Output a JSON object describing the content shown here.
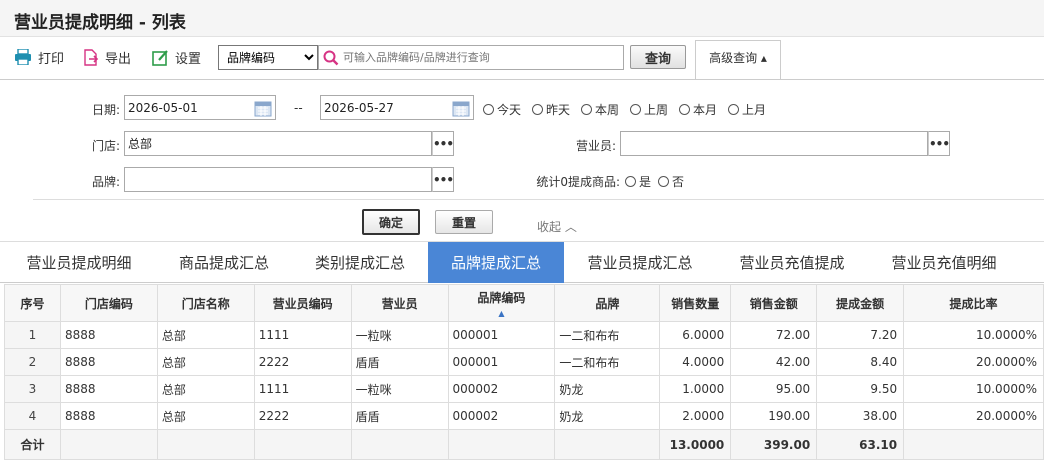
{
  "page_title": "营业员提成明细 - 列表",
  "toolbar": {
    "print_label": "打印",
    "export_label": "导出",
    "settings_label": "设置",
    "field_select_value": "品牌编码",
    "field_options": [
      "品牌编码"
    ],
    "search_placeholder": "可输入品牌编码/品牌进行查询",
    "query_label": "查询",
    "advanced_label": "高级查询 ▴"
  },
  "filters": {
    "date_label": "日期:",
    "date_from": "2026-05-01",
    "date_sep": "--",
    "date_to": "2026-05-27",
    "quick_dates": [
      "今天",
      "昨天",
      "本周",
      "上周",
      "本月",
      "上月"
    ],
    "store_label": "门店:",
    "store_value": "总部",
    "salesperson_label": "营业员:",
    "salesperson_value": "",
    "brand_label": "品牌:",
    "brand_value": "",
    "zero_label": "统计0提成商品:",
    "zero_yes": "是",
    "zero_no": "否",
    "dots": "•••",
    "confirm_label": "确定",
    "reset_label": "重置",
    "collapse_label": "收起 ︿"
  },
  "tabs": [
    "营业员提成明细",
    "商品提成汇总",
    "类别提成汇总",
    "品牌提成汇总",
    "营业员提成汇总",
    "营业员充值提成",
    "营业员充值明细"
  ],
  "active_tab": 3,
  "table": {
    "headers": [
      "序号",
      "门店编码",
      "门店名称",
      "营业员编码",
      "营业员",
      "品牌编码",
      "品牌",
      "销售数量",
      "销售金额",
      "提成金额",
      "提成比率"
    ],
    "sort_indicator": "▲",
    "rows": [
      [
        "1",
        "8888",
        "总部",
        "1111",
        "一粒咪",
        "000001",
        "一二和布布",
        "6.0000",
        "72.00",
        "7.20",
        "10.0000%"
      ],
      [
        "2",
        "8888",
        "总部",
        "2222",
        "盾盾",
        "000001",
        "一二和布布",
        "4.0000",
        "42.00",
        "8.40",
        "20.0000%"
      ],
      [
        "3",
        "8888",
        "总部",
        "1111",
        "一粒咪",
        "000002",
        "奶龙",
        "1.0000",
        "95.00",
        "9.50",
        "10.0000%"
      ],
      [
        "4",
        "8888",
        "总部",
        "2222",
        "盾盾",
        "000002",
        "奶龙",
        "2.0000",
        "190.00",
        "38.00",
        "20.0000%"
      ]
    ],
    "total_row": [
      "合计",
      "",
      "",
      "",
      "",
      "",
      "",
      "13.0000",
      "399.00",
      "63.10",
      ""
    ]
  },
  "colors": {
    "active_tab": "#4a86d6",
    "accent_pink": "#d63384",
    "accent_green": "#2e9d4a",
    "accent_teal": "#1e8fb0"
  }
}
